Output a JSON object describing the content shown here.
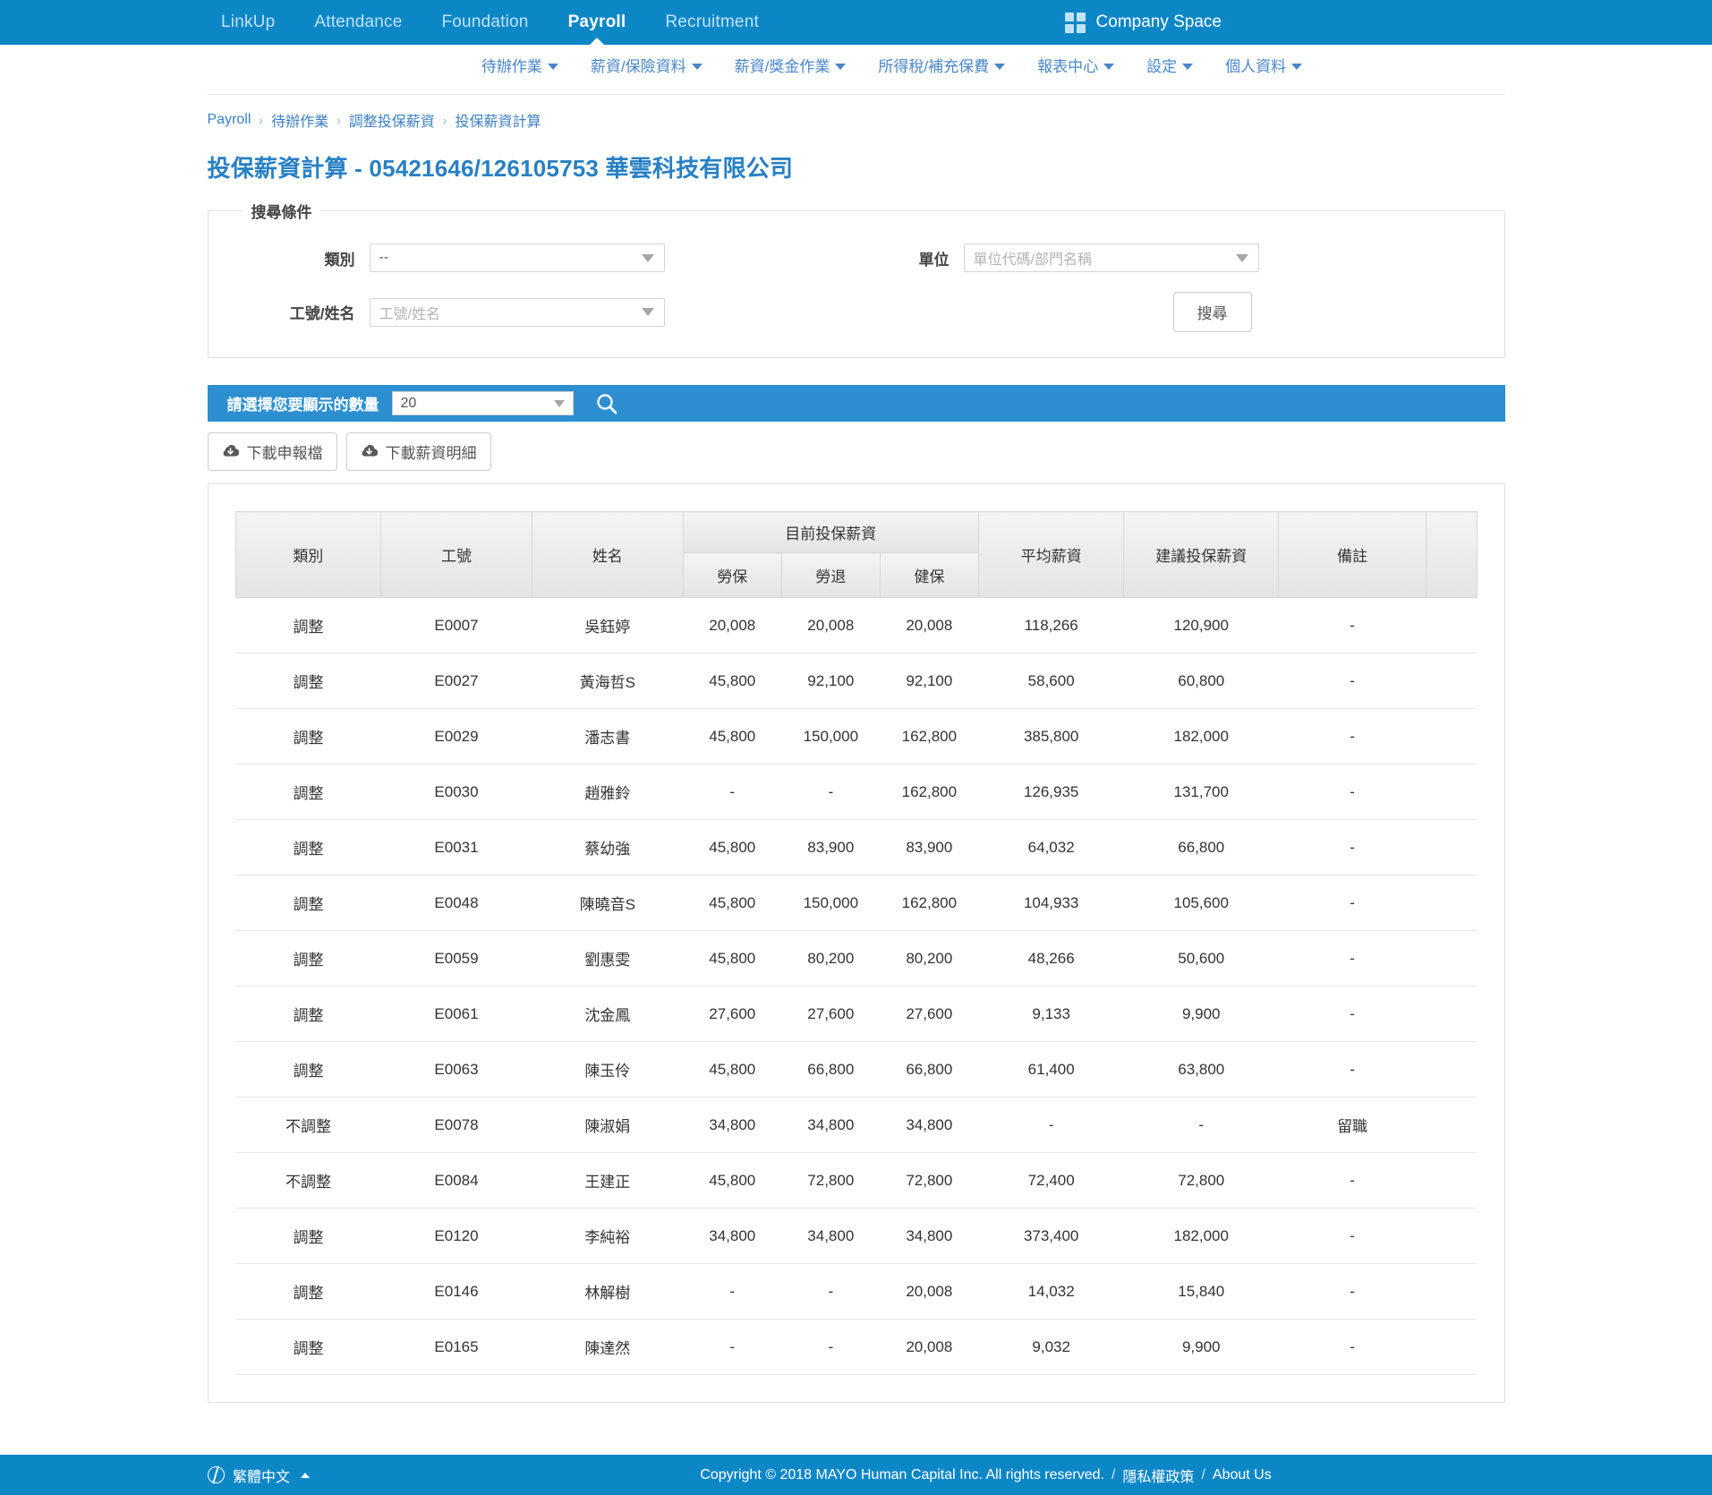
{
  "topnav": {
    "items": [
      {
        "label": "LinkUp",
        "active": false
      },
      {
        "label": "Attendance",
        "active": false
      },
      {
        "label": "Foundation",
        "active": false
      },
      {
        "label": "Payroll",
        "active": true
      },
      {
        "label": "Recruitment",
        "active": false
      }
    ],
    "company_space": "Company Space",
    "icon": "grid-icon",
    "bg_color": "#0c87c6"
  },
  "subnav": {
    "items": [
      "待辦作業",
      "薪資/保險資料",
      "薪資/獎金作業",
      "所得稅/補充保費",
      "報表中心",
      "設定",
      "個人資料"
    ]
  },
  "breadcrumb": {
    "items": [
      "Payroll",
      "待辦作業",
      "調整投保薪資",
      "投保薪資計算"
    ],
    "separator": "›"
  },
  "page_title": "投保薪資計算 - 05421646/126105753 華雲科技有限公司",
  "search": {
    "legend": "搜尋條件",
    "category_label": "類別",
    "category_value": "--",
    "employee_label": "工號/姓名",
    "employee_placeholder": "工號/姓名",
    "unit_label": "單位",
    "unit_placeholder": "單位代碼/部門名稱",
    "search_button": "搜尋"
  },
  "toolbar": {
    "count_label": "請選擇您要顯示的數量",
    "count_value": "20",
    "search_icon": "search-icon",
    "download_declaration": "下載申報檔",
    "download_payroll_detail": "下載薪資明細",
    "bar_color": "#2d8fd0"
  },
  "table": {
    "headers": {
      "category": "類別",
      "employee_id": "工號",
      "name": "姓名",
      "current_group": "目前投保薪資",
      "labor_insurance": "勞保",
      "labor_pension": "勞退",
      "health_insurance": "健保",
      "average_salary": "平均薪資",
      "suggested_salary": "建議投保薪資",
      "note": "備註",
      "blank": ""
    },
    "rows": [
      {
        "category": "調整",
        "id": "E0007",
        "name": "吳鈺婷",
        "labor": "20,008",
        "pension": "20,008",
        "health": "20,008",
        "avg": "118,266",
        "suggested": "120,900",
        "note": "-"
      },
      {
        "category": "調整",
        "id": "E0027",
        "name": "黃海哲S",
        "labor": "45,800",
        "pension": "92,100",
        "health": "92,100",
        "avg": "58,600",
        "suggested": "60,800",
        "note": "-"
      },
      {
        "category": "調整",
        "id": "E0029",
        "name": "潘志書",
        "labor": "45,800",
        "pension": "150,000",
        "health": "162,800",
        "avg": "385,800",
        "suggested": "182,000",
        "note": "-"
      },
      {
        "category": "調整",
        "id": "E0030",
        "name": "趙雅鈴",
        "labor": "-",
        "pension": "-",
        "health": "162,800",
        "avg": "126,935",
        "suggested": "131,700",
        "note": "-"
      },
      {
        "category": "調整",
        "id": "E0031",
        "name": "蔡幼強",
        "labor": "45,800",
        "pension": "83,900",
        "health": "83,900",
        "avg": "64,032",
        "suggested": "66,800",
        "note": "-"
      },
      {
        "category": "調整",
        "id": "E0048",
        "name": "陳曉音S",
        "labor": "45,800",
        "pension": "150,000",
        "health": "162,800",
        "avg": "104,933",
        "suggested": "105,600",
        "note": "-"
      },
      {
        "category": "調整",
        "id": "E0059",
        "name": "劉惠雯",
        "labor": "45,800",
        "pension": "80,200",
        "health": "80,200",
        "avg": "48,266",
        "suggested": "50,600",
        "note": "-"
      },
      {
        "category": "調整",
        "id": "E0061",
        "name": "沈金鳳",
        "labor": "27,600",
        "pension": "27,600",
        "health": "27,600",
        "avg": "9,133",
        "suggested": "9,900",
        "note": "-"
      },
      {
        "category": "調整",
        "id": "E0063",
        "name": "陳玉伶",
        "labor": "45,800",
        "pension": "66,800",
        "health": "66,800",
        "avg": "61,400",
        "suggested": "63,800",
        "note": "-"
      },
      {
        "category": "不調整",
        "id": "E0078",
        "name": "陳淑娟",
        "labor": "34,800",
        "pension": "34,800",
        "health": "34,800",
        "avg": "-",
        "suggested": "-",
        "note": "留職"
      },
      {
        "category": "不調整",
        "id": "E0084",
        "name": "王建正",
        "labor": "45,800",
        "pension": "72,800",
        "health": "72,800",
        "avg": "72,400",
        "suggested": "72,800",
        "note": "-"
      },
      {
        "category": "調整",
        "id": "E0120",
        "name": "李純裕",
        "labor": "34,800",
        "pension": "34,800",
        "health": "34,800",
        "avg": "373,400",
        "suggested": "182,000",
        "note": "-"
      },
      {
        "category": "調整",
        "id": "E0146",
        "name": "林解樹",
        "labor": "-",
        "pension": "-",
        "health": "20,008",
        "avg": "14,032",
        "suggested": "15,840",
        "note": "-"
      },
      {
        "category": "調整",
        "id": "E0165",
        "name": "陳達然",
        "labor": "-",
        "pension": "-",
        "health": "20,008",
        "avg": "9,032",
        "suggested": "9,900",
        "note": "-"
      }
    ]
  },
  "footer": {
    "language": "繁體中文",
    "copyright": "Copyright © 2018 MAYO Human Capital Inc. All rights reserved.",
    "privacy": "隱私權政策",
    "about": "About Us",
    "separator": "/"
  }
}
